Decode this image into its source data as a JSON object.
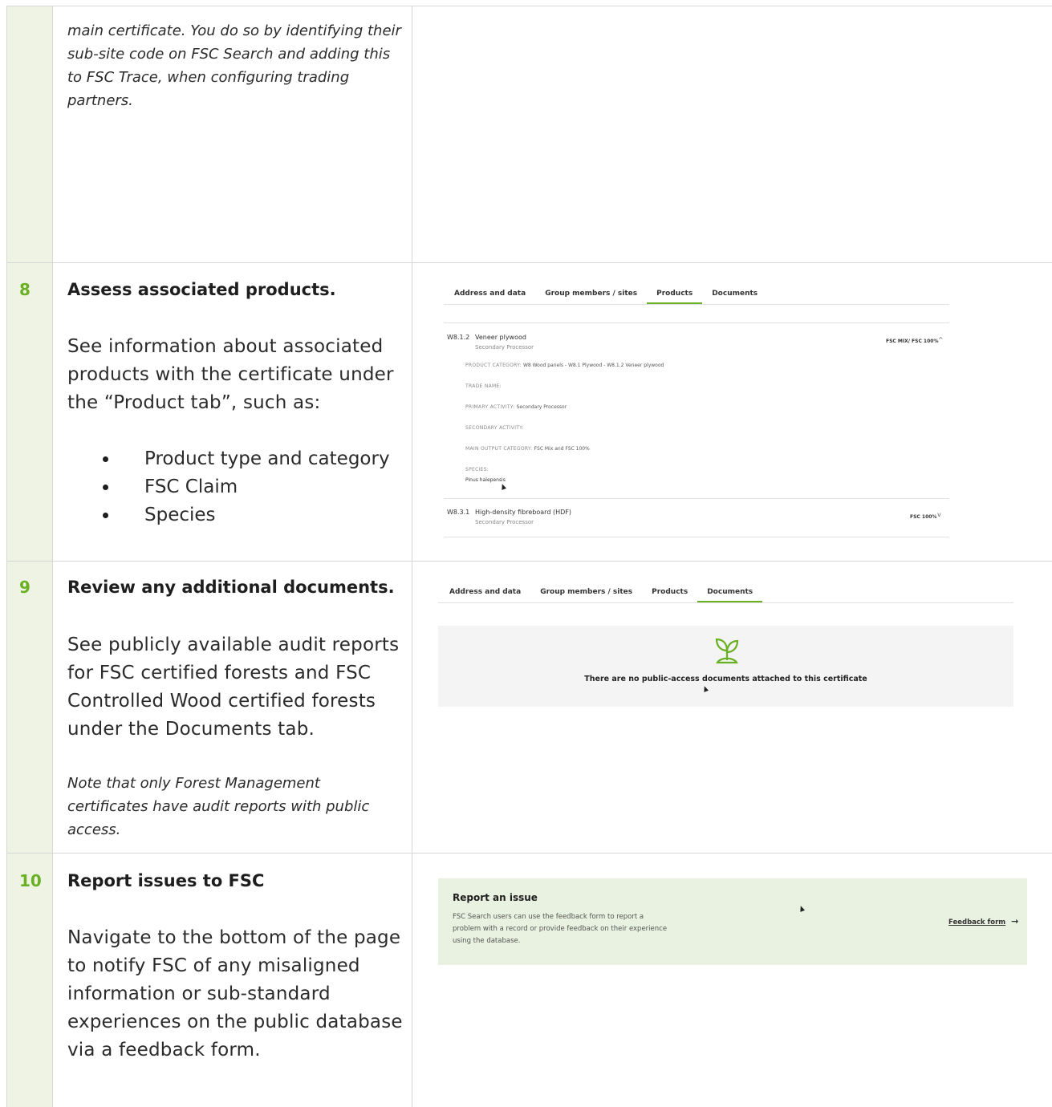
{
  "step_intro": {
    "text": "main certificate. You do so by identifying their sub-site code on FSC Search and adding this to FSC Trace, when configuring trading partners."
  },
  "step8": {
    "number": "8",
    "title": "Assess associated products.",
    "body": "See information about associated products with the certificate under the “Product tab”, such as:",
    "bullets": [
      "Product type and category",
      "FSC Claim",
      "Species"
    ],
    "screenshot": {
      "tabs": [
        "Address and data",
        "Group members / sites",
        "Products",
        "Documents"
      ],
      "active_tab": "Products",
      "product1": {
        "code": "W8.1.2",
        "name": "Veneer plywood",
        "role": "Secondary Processor",
        "claim": "FSC MIX/ FSC 100%",
        "product_category_label": "PRODUCT CATEGORY:",
        "product_category": "W8 Wood panels - W8.1 Plywood - W8.1.2 Veneer plywood",
        "trade_name_label": "TRADE NAME:",
        "primary_activity_label": "PRIMARY ACTIVITY:",
        "primary_activity": "Secondary Processor",
        "secondary_activity_label": "SECONDARY ACTIVITY:",
        "main_output_label": "MAIN OUTPUT CATEGORY:",
        "main_output": "FSC Mix and FSC 100%",
        "species_label": "SPECIES:",
        "species": "Pinus halepensis"
      },
      "product2": {
        "code": "W8.3.1",
        "name": "High-density fibreboard (HDF)",
        "role": "Secondary Processor",
        "claim": "FSC 100%"
      }
    }
  },
  "step9": {
    "number": "9",
    "title": "Review any additional documents.",
    "body": "See publicly available audit reports for FSC certified forests and FSC Controlled Wood certified forests under the Documents tab.",
    "note": "Note that only Forest Management certificates have audit reports with public access.",
    "screenshot": {
      "tabs": [
        "Address and data",
        "Group members / sites",
        "Products",
        "Documents"
      ],
      "active_tab": "Documents",
      "empty_message": "There are no public-access documents attached to this certificate",
      "icon": "sprout-icon"
    }
  },
  "step10": {
    "number": "10",
    "title": "Report issues to FSC",
    "body": "Navigate to the bottom of the page to notify FSC of any misaligned information or sub-standard experiences on the public database via a feedback form.",
    "screenshot": {
      "heading": "Report an issue",
      "text": "FSC Search users can use the feedback form to report a problem with a record or provide feedback on their experience using the database.",
      "link": "Feedback form",
      "link_arrow": "→"
    }
  },
  "colors": {
    "accent_green": "#6ab023",
    "number_column_bg": "#eef3e4",
    "report_box_bg": "#e9f1e0"
  }
}
